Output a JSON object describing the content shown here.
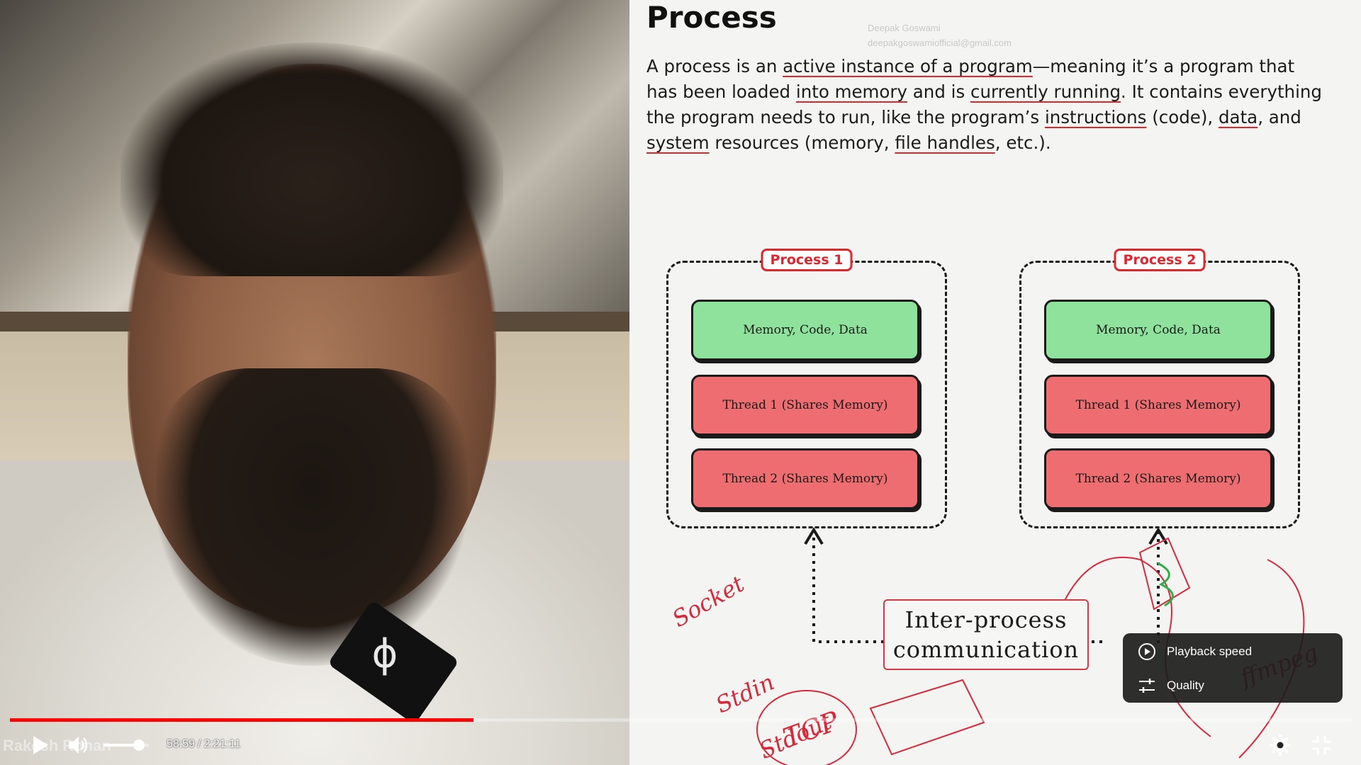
{
  "slide": {
    "title": "Process",
    "watermark_name": "Deepak Goswami",
    "watermark_email": "deepakgoswamiofficial@gmail.com",
    "paragraph": {
      "p1": "A process is an ",
      "u1": "active instance of a program",
      "p2": "—meaning it’s a program that has been loaded ",
      "u2": "into memory",
      "p3": " and is ",
      "u3": "currently running",
      "p4": ". It contains everything the program needs to run, like the program’s ",
      "u4": "instructions",
      "p5": " (code), ",
      "u5": "data",
      "p6": ", and ",
      "u6": "system",
      "p7": " resources (memory, ",
      "u7": "file handles",
      "p8": ", etc.)."
    },
    "process1": {
      "label": "Process 1",
      "block_memory": "Memory, Code, Data",
      "block_thread1": "Thread 1 (Shares Memory)",
      "block_thread2": "Thread 2 (Shares Memory)"
    },
    "process2": {
      "label": "Process 2",
      "block_memory": "Memory, Code, Data",
      "block_thread1": "Thread 1 (Shares Memory)",
      "block_thread2": "Thread 2 (Shares Memory)"
    },
    "ipc_line1": "Inter-process",
    "ipc_line2": "communication",
    "annotations": {
      "socket": "Socket",
      "stdin": "Stdin",
      "stdout": "Stdout",
      "tcp": "TCP",
      "ffmpeg": "ffmpeg"
    }
  },
  "overlay": {
    "speaker_name": "Rakesh Rohan"
  },
  "player": {
    "current_time": "58:59",
    "separator": "/",
    "duration": "2:21:11",
    "progress_fraction": 0.3455,
    "volume_fraction": 0.78,
    "accent_color": "#ff0000",
    "settings_menu": {
      "playback_speed_label": "Playback speed",
      "quality_label": "Quality"
    },
    "icons": {
      "play": "play-icon",
      "volume": "volume-icon",
      "settings": "gear-icon",
      "exit_fullscreen": "exit-fullscreen-icon"
    }
  }
}
